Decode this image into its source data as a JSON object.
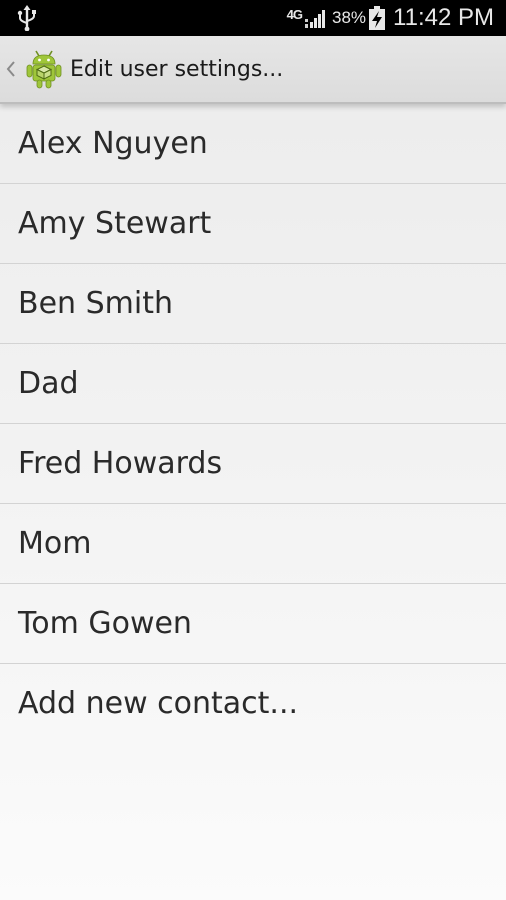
{
  "status_bar": {
    "network": "4G",
    "battery_percent": "38%",
    "time": "11:42 PM",
    "icons": [
      "usb-icon",
      "signal-icon",
      "battery-charging-icon"
    ]
  },
  "action_bar": {
    "title": "Edit user settings...",
    "icons": [
      "back-chevron-icon",
      "android-app-icon"
    ]
  },
  "contacts": [
    {
      "label": "Alex Nguyen"
    },
    {
      "label": "Amy Stewart"
    },
    {
      "label": "Ben Smith"
    },
    {
      "label": "Dad"
    },
    {
      "label": "Fred Howards"
    },
    {
      "label": "Mom"
    },
    {
      "label": "Tom Gowen"
    }
  ],
  "add_contact_label": "Add new contact...",
  "colors": {
    "status_bar": "#000000",
    "action_bar": "#e2e2e2",
    "android_green": "#9fc63a",
    "background": "#efefef"
  }
}
